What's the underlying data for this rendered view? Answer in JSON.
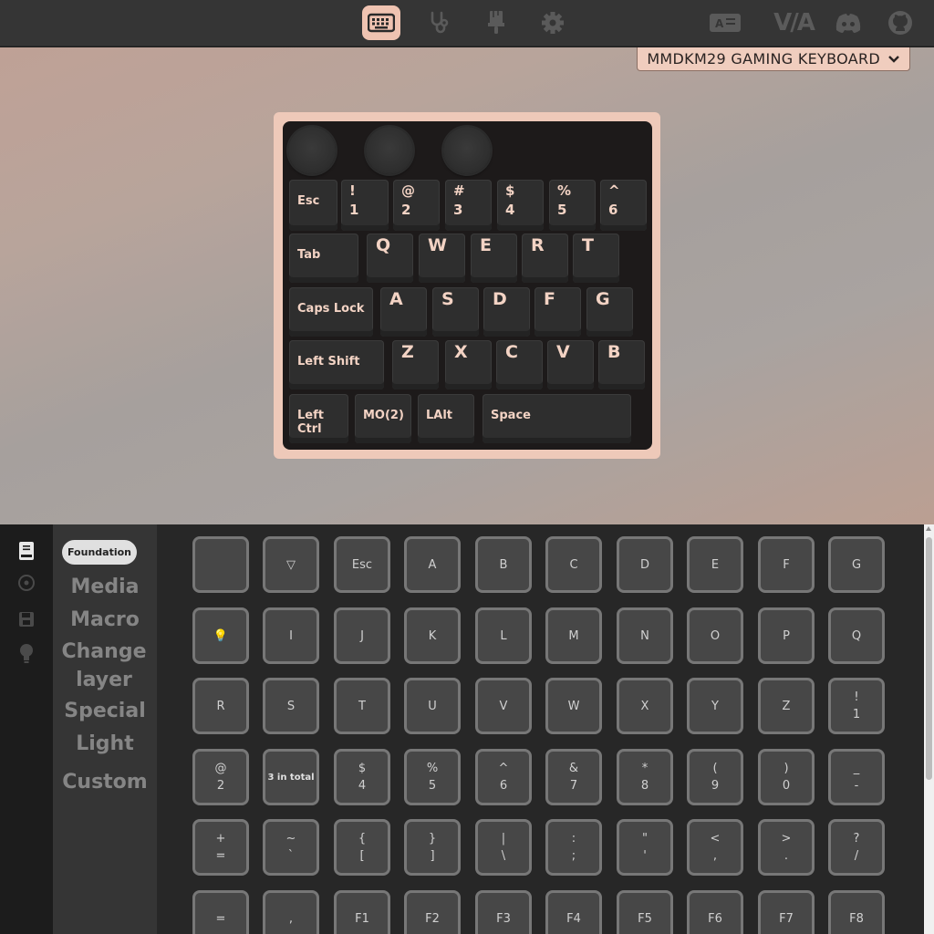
{
  "topbar": {
    "nav": [
      {
        "name": "keyboard-icon",
        "active": true
      },
      {
        "name": "stethoscope-icon",
        "active": false
      },
      {
        "name": "brush-icon",
        "active": false
      },
      {
        "name": "gear-icon",
        "active": false
      }
    ],
    "external": [
      {
        "name": "language-icon"
      },
      {
        "name": "via-logo-icon",
        "text": "V/A"
      },
      {
        "name": "discord-icon"
      },
      {
        "name": "github-icon"
      }
    ],
    "accent": "#efc3b1"
  },
  "keyboard_selector": {
    "label": "MMDKM29 GAMING KEYBOARD"
  },
  "keyboard": {
    "knobs": 3,
    "rows": [
      [
        {
          "top": "Esc"
        },
        {
          "top": "!",
          "bottom": "1"
        },
        {
          "top": "@",
          "bottom": "2"
        },
        {
          "top": "#",
          "bottom": "3"
        },
        {
          "top": "$",
          "bottom": "4"
        },
        {
          "top": "%",
          "bottom": "5"
        },
        {
          "top": "^",
          "bottom": "6"
        }
      ],
      [
        {
          "top": "Tab"
        },
        {
          "top": "Q"
        },
        {
          "top": "W"
        },
        {
          "top": "E"
        },
        {
          "top": "R"
        },
        {
          "top": "T"
        }
      ],
      [
        {
          "top": "Caps Lock"
        },
        {
          "top": "A"
        },
        {
          "top": "S"
        },
        {
          "top": "D"
        },
        {
          "top": "F"
        },
        {
          "top": "G"
        }
      ],
      [
        {
          "top": "Left Shift"
        },
        {
          "top": "Z"
        },
        {
          "top": "X"
        },
        {
          "top": "C"
        },
        {
          "top": "V"
        },
        {
          "top": "B"
        }
      ],
      [
        {
          "top": "Left Ctrl"
        },
        {
          "top": "MO(2)"
        },
        {
          "top": "LAlt"
        },
        {
          "top": "Space"
        }
      ]
    ]
  },
  "sidebar": {
    "icons": [
      "book-icon",
      "circle-dot-icon",
      "save-icon",
      "lightbulb-icon"
    ]
  },
  "categories": {
    "selected": "Foundation",
    "items": [
      "Media",
      "Macro",
      "Change layer",
      "Special",
      "Light",
      "Custom"
    ]
  },
  "keycodes": [
    [
      {
        "t": ""
      },
      {
        "t": "▽"
      },
      {
        "t": "Esc"
      },
      {
        "t": "A"
      },
      {
        "t": "B"
      },
      {
        "t": "C"
      },
      {
        "t": "D"
      },
      {
        "t": "E"
      },
      {
        "t": "F"
      },
      {
        "t": "G"
      }
    ],
    [
      {
        "t": "💡"
      },
      {
        "t": "I"
      },
      {
        "t": "J"
      },
      {
        "t": "K"
      },
      {
        "t": "L"
      },
      {
        "t": "M"
      },
      {
        "t": "N"
      },
      {
        "t": "O"
      },
      {
        "t": "P"
      },
      {
        "t": "Q"
      }
    ],
    [
      {
        "t": "R"
      },
      {
        "t": "S"
      },
      {
        "t": "T"
      },
      {
        "t": "U"
      },
      {
        "t": "V"
      },
      {
        "t": "W"
      },
      {
        "t": "X"
      },
      {
        "t": "Y"
      },
      {
        "t": "Z"
      },
      {
        "t": "!",
        "b": "1"
      }
    ],
    [
      {
        "t": "@",
        "b": "2"
      },
      {
        "t": "3 in total"
      },
      {
        "t": "$",
        "b": "4"
      },
      {
        "t": "%",
        "b": "5"
      },
      {
        "t": "^",
        "b": "6"
      },
      {
        "t": "&",
        "b": "7"
      },
      {
        "t": "*",
        "b": "8"
      },
      {
        "t": "(",
        "b": "9"
      },
      {
        "t": ")",
        "b": "0"
      },
      {
        "t": "_",
        "b": "-"
      }
    ],
    [
      {
        "t": "+",
        "b": "="
      },
      {
        "t": "~",
        "b": "`"
      },
      {
        "t": "{",
        "b": "["
      },
      {
        "t": "}",
        "b": "]"
      },
      {
        "t": "|",
        "b": "\\"
      },
      {
        "t": ":",
        "b": ";"
      },
      {
        "t": "\"",
        "b": "'"
      },
      {
        "t": "<",
        "b": ","
      },
      {
        "t": ">",
        "b": "."
      },
      {
        "t": "?",
        "b": "/"
      }
    ],
    [
      {
        "t": "="
      },
      {
        "t": ","
      },
      {
        "t": "F1"
      },
      {
        "t": "F2"
      },
      {
        "t": "F3"
      },
      {
        "t": "F4"
      },
      {
        "t": "F5"
      },
      {
        "t": "F6"
      },
      {
        "t": "F7"
      },
      {
        "t": "F8"
      }
    ]
  ]
}
